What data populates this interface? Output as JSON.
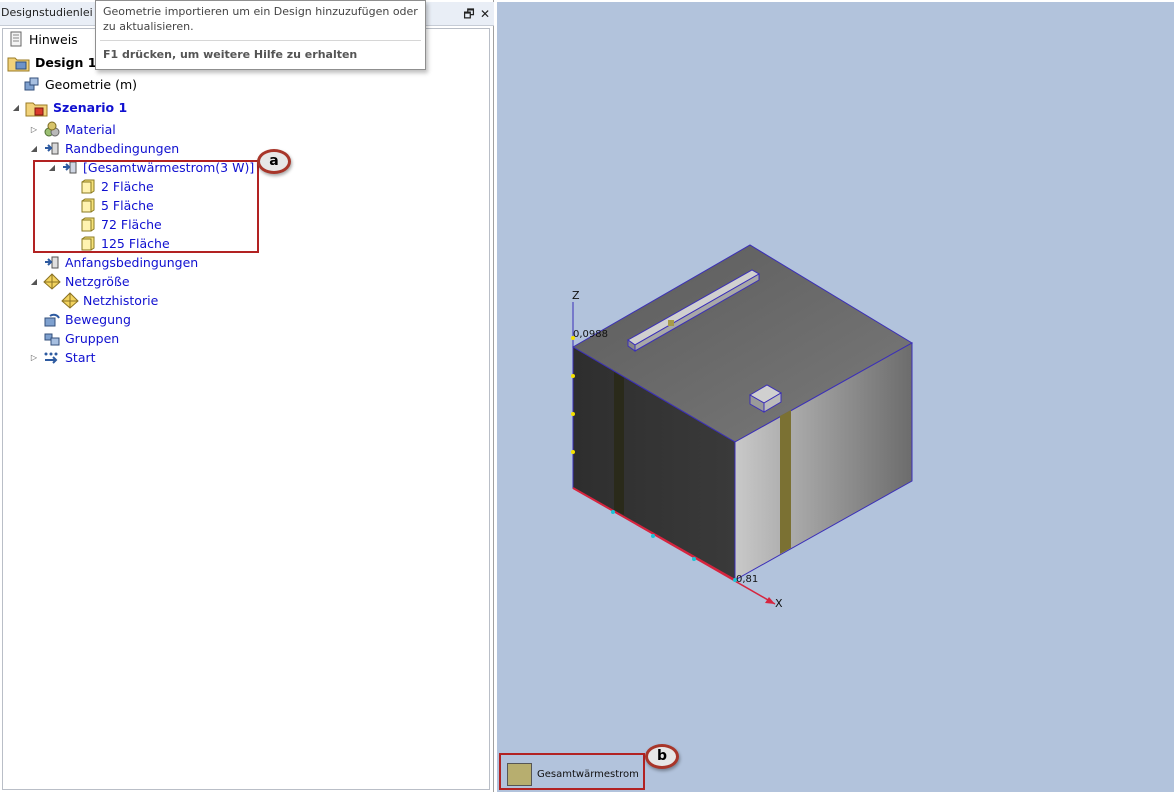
{
  "panel": {
    "title": "Designstudienleiste",
    "restore_icon": "🗗",
    "close_icon": "✕"
  },
  "tooltip": {
    "text": "Geometrie importieren um ein Design hinzuzufügen oder zu aktualisieren.",
    "help": "F1 drücken, um weitere Hilfe zu erhalten"
  },
  "tree": {
    "hinweis": "Hinweis",
    "design": "Design 1",
    "geometrie": "Geometrie (m)",
    "szenario": "Szenario 1",
    "material": "Material",
    "randbedingungen": "Randbedingungen",
    "gesamtwaermestrom": "[Gesamtwärmestrom(3 W)]",
    "flaechen": [
      "2 Fläche",
      "5 Fläche",
      "72 Fläche",
      "125 Fläche"
    ],
    "anfangsbedingungen": "Anfangsbedingungen",
    "netzgroesse": "Netzgröße",
    "netzhistorie": "Netzhistorie",
    "bewegung": "Bewegung",
    "gruppen": "Gruppen",
    "start": "Start"
  },
  "callouts": {
    "a": "a",
    "b": "b"
  },
  "viewport": {
    "axis_z": "Z",
    "axis_x": "X",
    "z_value": "0,0988",
    "x_value": "0,81"
  },
  "legend": {
    "label": "Gesamtwärmestrom",
    "color": "#b7ae6f"
  },
  "colors": {
    "viewport_bg": "#b2c3dc",
    "link_blue": "#1010d0",
    "callout_red": "#b22222"
  }
}
